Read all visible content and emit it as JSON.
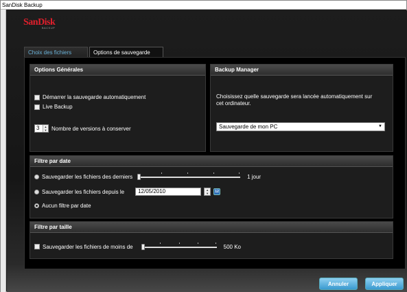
{
  "window": {
    "title": "SanDisk Backup"
  },
  "logo": {
    "brand": "SanDisk",
    "sub": "BACKUP"
  },
  "tabs": [
    {
      "label": "Choix des fichiers",
      "active": false
    },
    {
      "label": "Options de sauvegarde",
      "active": true
    }
  ],
  "general": {
    "title": "Options Générales",
    "auto_start": {
      "label": "Démarrer la sauvegarde automatiquement",
      "checked": false
    },
    "live_backup": {
      "label": "Live Backup",
      "checked": false
    },
    "versions": {
      "value": "3",
      "label": "Nombre de versions à conserver"
    }
  },
  "manager": {
    "title": "Backup Manager",
    "description": "Choisissez quelle sauvegarde sera lancée automatiquement sur cet ordinateur.",
    "selected": "Sauvegarde de mon PC"
  },
  "date_filter": {
    "title": "Filtre par date",
    "last": {
      "label": "Sauvegarder les fichiers des derniers",
      "value": "1 jour",
      "checked": false
    },
    "since": {
      "label": "Sauvegarder les fichiers depuis le",
      "date": "12/05/2010",
      "checked": false
    },
    "none": {
      "label": "Aucun filtre par date",
      "checked": true
    },
    "calendar_icon_text": "12"
  },
  "size_filter": {
    "title": "Filtre par taille",
    "below": {
      "label": "Sauvegarder les fichiers de moins de",
      "value": "500 Ko",
      "checked": false
    }
  },
  "buttons": {
    "cancel": "Annuler",
    "apply": "Appliquer"
  },
  "colors": {
    "accent": "#3a9ad0",
    "brand": "#e01f2c",
    "tab_inactive_text": "#6ab2d8"
  },
  "icons": {
    "spinner": "up-down-arrows-icon",
    "dropdown": "chevron-down-icon",
    "calendar": "calendar-icon"
  }
}
